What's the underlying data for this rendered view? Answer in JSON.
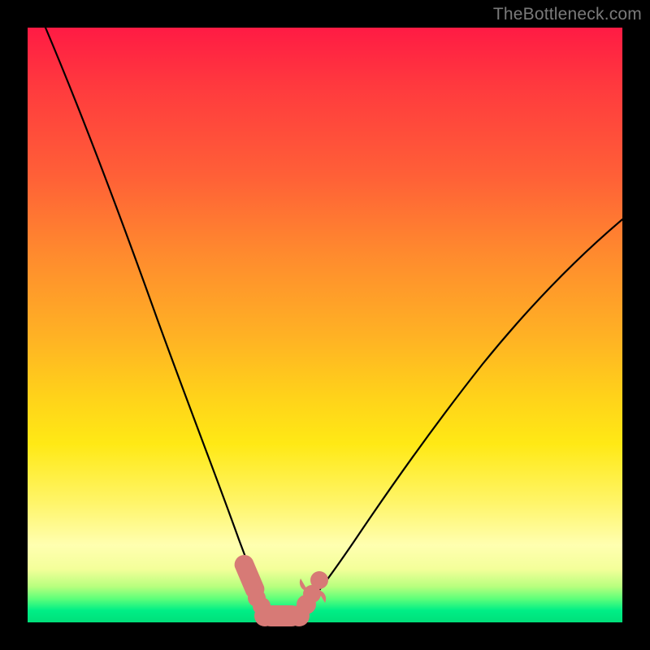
{
  "watermark": "TheBottleneck.com",
  "chart_data": {
    "type": "line",
    "title": "",
    "xlabel": "",
    "ylabel": "",
    "xlim": [
      0,
      100
    ],
    "ylim": [
      0,
      100
    ],
    "grid": false,
    "legend": false,
    "series": [
      {
        "name": "bottleneck-curve-left",
        "x": [
          3,
          6,
          10,
          14,
          18,
          22,
          26,
          29,
          32,
          34.5,
          36.5,
          38,
          39,
          40
        ],
        "y": [
          100,
          92,
          80,
          68,
          56,
          44,
          33,
          24,
          16,
          10,
          6,
          3.5,
          2,
          1.5
        ]
      },
      {
        "name": "bottleneck-curve-right",
        "x": [
          46,
          48,
          51,
          55,
          60,
          66,
          73,
          81,
          90,
          100
        ],
        "y": [
          1.5,
          3,
          6,
          11,
          18,
          27,
          37,
          48,
          58,
          68
        ]
      }
    ],
    "markers": [
      {
        "shape": "pill",
        "x1": 35.0,
        "y1": 9.0,
        "x2": 37.0,
        "y2": 4.5,
        "r": 1.6
      },
      {
        "shape": "pill",
        "x1": 37.8,
        "y1": 3.6,
        "x2": 38.8,
        "y2": 2.2,
        "r": 1.6
      },
      {
        "shape": "pill",
        "x1": 39.2,
        "y1": 1.7,
        "x2": 45.5,
        "y2": 1.2,
        "r": 1.8
      },
      {
        "shape": "round",
        "cx": 46.7,
        "cy": 2.8,
        "r": 1.7
      },
      {
        "shape": "pill",
        "x1": 47.4,
        "y1": 4.6,
        "x2": 48.8,
        "y2": 7.2,
        "r": 1.6
      }
    ],
    "background_gradient": {
      "top": "#ff1b44",
      "mid": "#ffe915",
      "bottom": "#00e07a"
    }
  }
}
